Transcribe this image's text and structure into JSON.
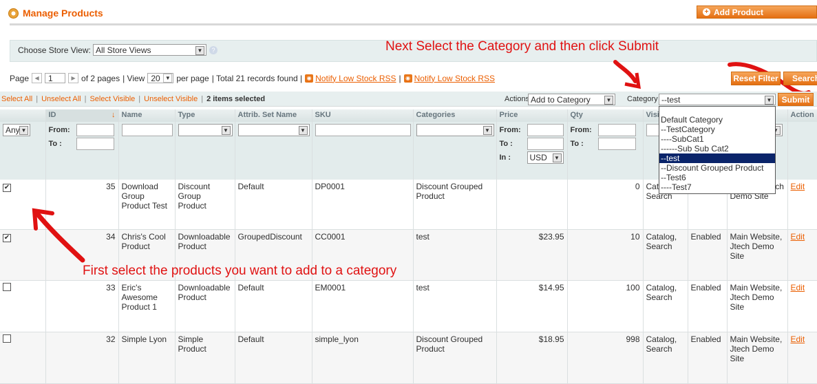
{
  "header": {
    "title": "Manage Products",
    "add_button": "Add Product"
  },
  "store": {
    "label": "Choose Store View:",
    "value": "All Store Views"
  },
  "annotations": {
    "top": "Next Select the Category and then click Submit",
    "bottom": "First select the products you want to add to a category"
  },
  "pager": {
    "page_label": "Page",
    "page": "1",
    "of": "of 2 pages",
    "view_label": "| View",
    "per_page": "20",
    "per_page_suffix": "per page",
    "total": "| Total 21 records found |",
    "rss1": "Notify Low Stock RSS",
    "sep": "|",
    "rss2": "Notify Low Stock RSS"
  },
  "buttons": {
    "reset": "Reset Filter",
    "search": "Search",
    "submit": "Submit"
  },
  "mass": {
    "select_all": "Select All",
    "unselect_all": "Unselect All",
    "select_visible": "Select Visible",
    "unselect_visible": "Unselect Visible",
    "selected": "2 items selected",
    "actions_label": "Actions",
    "action_value": "Add to Category",
    "category_label": "Category",
    "category_value": "--test"
  },
  "dropdown": [
    "Default Category",
    "--TestCategory",
    "----SubCat1",
    "------Sub Sub Cat2",
    "--test",
    "--Discount Grouped Product",
    "--Test6",
    "----Test7"
  ],
  "columns": [
    "",
    "ID",
    "Name",
    "Type",
    "Attrib. Set Name",
    "SKU",
    "Categories",
    "Price",
    "Qty",
    "Visi",
    "",
    "",
    "Action"
  ],
  "filters": {
    "any": "Any",
    "from": "From:",
    "to": "To :",
    "in": "In :",
    "currency": "USD"
  },
  "rows": [
    {
      "checked": "✔",
      "id": "35",
      "name": "Download Group Product Test",
      "type": "Discount Group Product",
      "attr": "Default",
      "sku": "DP0001",
      "cat": "Discount Grouped Product",
      "price": "",
      "qty": "0",
      "vis": "Catalog, Search",
      "status": "",
      "web": "Website, Jtech Demo Site",
      "action": "Edit"
    },
    {
      "checked": "✔",
      "id": "34",
      "name": "Chris's Cool Product",
      "type": "Downloadable Product",
      "attr": "GroupedDiscount",
      "sku": "CC0001",
      "cat": "test",
      "price": "$23.95",
      "qty": "10",
      "vis": "Catalog, Search",
      "status": "Enabled",
      "web": "Main Website, Jtech Demo Site",
      "action": "Edit"
    },
    {
      "checked": "",
      "id": "33",
      "name": "Eric's Awesome Product 1",
      "type": "Downloadable Product",
      "attr": "Default",
      "sku": "EM0001",
      "cat": "test",
      "price": "$14.95",
      "qty": "100",
      "vis": "Catalog, Search",
      "status": "Enabled",
      "web": "Main Website, Jtech Demo Site",
      "action": "Edit"
    },
    {
      "checked": "",
      "id": "32",
      "name": "Simple Lyon",
      "type": "Simple Product",
      "attr": "Default",
      "sku": "simple_lyon",
      "cat": "Discount Grouped Product",
      "price": "$18.95",
      "qty": "998",
      "vis": "Catalog, Search",
      "status": "Enabled",
      "web": "Main Website, Jtech Demo Site",
      "action": "Edit"
    }
  ],
  "colors": {
    "accent": "#eb5e00",
    "annotation": "#e01212",
    "header_bg": "#e7efef"
  }
}
